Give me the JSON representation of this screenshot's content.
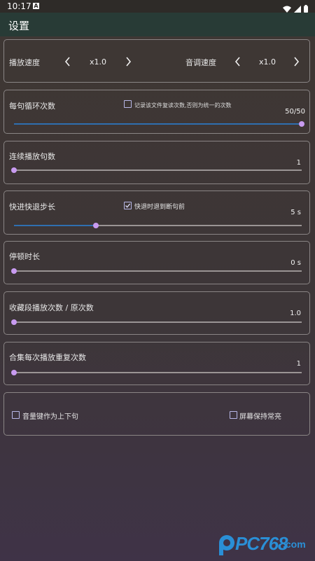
{
  "status_bar": {
    "time": "10:17",
    "notification_icon": "a-box-icon",
    "icons": [
      "wifi-icon",
      "signal-icon",
      "battery-icon"
    ]
  },
  "app_bar": {
    "title": "设置"
  },
  "speed_card": {
    "play_speed_label": "播放速度",
    "play_speed_value": "x1.0",
    "pitch_speed_label": "音调速度",
    "pitch_speed_value": "x1.0"
  },
  "loop_card": {
    "label": "每句循环次数",
    "checkbox_label": "记录该文件复读次数,否则为统一的次数",
    "checkbox_checked": false,
    "value_text": "50/50",
    "slider_fraction": 1.0
  },
  "continuous_card": {
    "label": "连续播放句数",
    "value_text": "1",
    "slider_fraction": 0.0
  },
  "step_card": {
    "label": "快进快退步长",
    "checkbox_label": "快退时退到断句前",
    "checkbox_checked": true,
    "value_text": "5 s",
    "slider_fraction": 0.285
  },
  "pause_card": {
    "label": "停顿时长",
    "value_text": "0 s",
    "slider_fraction": 0.0
  },
  "favorite_card": {
    "label": "收藏段播放次数 / 原次数",
    "value_text": "1.0",
    "slider_fraction": 0.0
  },
  "collection_card": {
    "label": "合集每次播放重复次数",
    "value_text": "1",
    "slider_fraction": 0.0
  },
  "options_card": {
    "volume_key_label": "音量键作为上下句",
    "volume_key_checked": false,
    "keep_screen_label": "屏幕保持常亮",
    "keep_screen_checked": false
  },
  "watermark": {
    "text": "PC768",
    "suffix": ".com"
  },
  "colors": {
    "app_bar": "#283b36",
    "slider_fill": "#2f6fb0",
    "slider_thumb": "#c89bf0",
    "card_border": "#8a8585"
  }
}
